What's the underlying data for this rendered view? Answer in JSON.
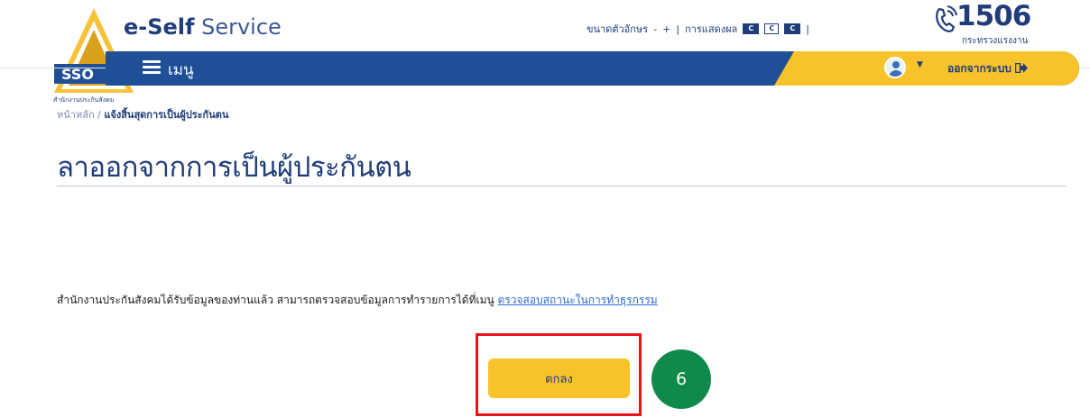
{
  "header": {
    "brand_bold": "e-Self",
    "brand_light": " Service",
    "logo_caption": "สำนักงานประกันสังคม",
    "font_size_label": "ขนาดตัวอักษร",
    "font_minus": "-",
    "font_plus": "+",
    "divider": "|",
    "display_label": "การแสดงผล",
    "display_options": [
      "C",
      "C",
      "C"
    ],
    "hotline_number": "1506",
    "hotline_sub": "กระทรวงแรงงาน",
    "menu_label": "เมนู",
    "logout_label": "ออกจากระบบ"
  },
  "breadcrumb": {
    "home": "หน้าหลัก",
    "separator": " / ",
    "current": "แจ้งสิ้นสุดการเป็นผู้ประกันตน"
  },
  "page": {
    "title": "ลาออกจากการเป็นผู้ประกันตน",
    "message": "สำนักงานประกันสังคมได้รับข้อมูลของท่านแล้ว สามารถตรวจสอบข้อมูลการทำรายการได้ที่เมนู ",
    "message_link": "ตรวจสอบสถานะในการทำธุรกรรม",
    "ok_button": "ตกลง"
  },
  "annotation": {
    "step_number": "6",
    "highlight_color": "#e8141a",
    "step_color": "#0f8a4a"
  },
  "colors": {
    "navy": "#1f4f97",
    "yellow": "#f8c22b",
    "text_dark": "#1f3d7a"
  }
}
